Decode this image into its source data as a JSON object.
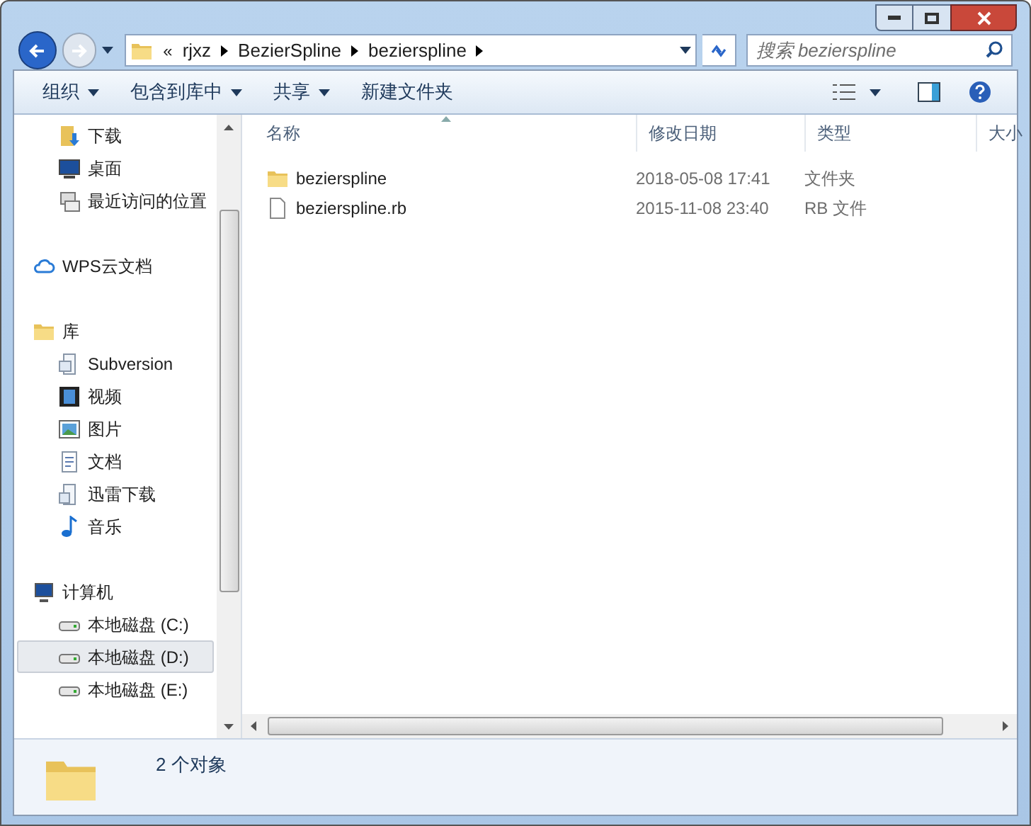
{
  "address": {
    "overflow": "«",
    "crumbs": [
      "rjxz",
      "BezierSpline",
      "bezierspline"
    ]
  },
  "search": {
    "placeholder": "搜索 bezierspline"
  },
  "toolbar": {
    "buttons": [
      {
        "label": "组织",
        "dropdown": true
      },
      {
        "label": "包含到库中",
        "dropdown": true
      },
      {
        "label": "共享",
        "dropdown": true
      },
      {
        "label": "新建文件夹",
        "dropdown": false
      }
    ]
  },
  "sidebar": {
    "sections": [
      {
        "items": [
          {
            "label": "下载",
            "selected": false
          },
          {
            "label": "桌面",
            "selected": false
          },
          {
            "label": "最近访问的位置",
            "selected": false
          }
        ]
      },
      {
        "label": "WPS云文档"
      },
      {
        "label": "库",
        "items": [
          {
            "label": "Subversion",
            "selected": false
          },
          {
            "label": "视频",
            "selected": false
          },
          {
            "label": "图片",
            "selected": false
          },
          {
            "label": "文档",
            "selected": false
          },
          {
            "label": "迅雷下载",
            "selected": false
          },
          {
            "label": "音乐",
            "selected": false
          }
        ]
      },
      {
        "label": "计算机",
        "items": [
          {
            "label": "本地磁盘 (C:)",
            "selected": false
          },
          {
            "label": "本地磁盘 (D:)",
            "selected": true
          },
          {
            "label": "本地磁盘 (E:)",
            "selected": false
          }
        ]
      }
    ]
  },
  "table": {
    "columns": [
      {
        "label": "名称",
        "sorted": true
      },
      {
        "label": "修改日期",
        "sorted": false
      },
      {
        "label": "类型",
        "sorted": false
      },
      {
        "label": "大小",
        "sorted": false
      }
    ],
    "rows": [
      {
        "kind": "folder",
        "name": "bezierspline",
        "date": "2018-05-08 17:41",
        "type": "文件夹"
      },
      {
        "kind": "file",
        "name": "bezierspline.rb",
        "date": "2015-11-08 23:40",
        "type": "RB 文件"
      }
    ]
  },
  "status_bar": {
    "text": "2 个对象"
  }
}
